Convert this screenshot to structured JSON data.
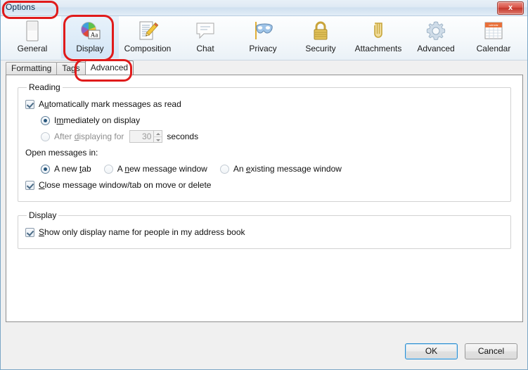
{
  "window": {
    "title": "Options",
    "close_label": "x",
    "close_icon": "close-icon"
  },
  "toolbar": {
    "items": [
      {
        "label": "General",
        "icon": "general-document-icon",
        "selected": false
      },
      {
        "label": "Display",
        "icon": "display-colorwheel-icon",
        "selected": true
      },
      {
        "label": "Composition",
        "icon": "composition-pencil-icon",
        "selected": false
      },
      {
        "label": "Chat",
        "icon": "chat-bubble-icon",
        "selected": false
      },
      {
        "label": "Privacy",
        "icon": "privacy-mask-icon",
        "selected": false
      },
      {
        "label": "Security",
        "icon": "security-padlock-icon",
        "selected": false
      },
      {
        "label": "Attachments",
        "icon": "attachments-paperclip-icon",
        "selected": false
      },
      {
        "label": "Advanced",
        "icon": "advanced-gear-icon",
        "selected": false
      },
      {
        "label": "Calendar",
        "icon": "calendar-icon",
        "selected": false
      }
    ]
  },
  "tabs": [
    {
      "label": "Formatting",
      "active": false
    },
    {
      "label": "Tags",
      "active": false
    },
    {
      "label": "Advanced",
      "active": true
    }
  ],
  "reading": {
    "legend": "Reading",
    "auto_mark": {
      "label_pre": "A",
      "label_accel": "u",
      "label_post": "tomatically mark messages as read",
      "checked": true
    },
    "immediately": {
      "label_pre": "I",
      "label_accel": "m",
      "label_post": "mediately on display",
      "selected": true
    },
    "after_displaying": {
      "label_pre": "After ",
      "label_accel": "d",
      "label_post": "isplaying for",
      "selected": false,
      "value": "30",
      "units": "seconds"
    },
    "open_messages_label": "Open messages in:",
    "open_options": [
      {
        "pre": "A new ",
        "accel": "t",
        "post": "ab",
        "selected": true
      },
      {
        "pre": "A ",
        "accel": "n",
        "post": "ew message window",
        "selected": false
      },
      {
        "pre": "An ",
        "accel": "e",
        "post": "xisting message window",
        "selected": false
      }
    ],
    "close_on_move": {
      "label_pre": "",
      "label_accel": "C",
      "label_post": "lose message window/tab on move or delete",
      "checked": true
    }
  },
  "display": {
    "legend": "Display",
    "show_only_display_name": {
      "label_pre": "",
      "label_accel": "S",
      "label_post": "how only display name for people in my address book",
      "checked": true
    }
  },
  "footer": {
    "ok_label": "OK",
    "cancel_label": "Cancel"
  },
  "colors": {
    "accent": "#2c8fd1",
    "annotation": "#e01b1b",
    "close_red": "#c3362c",
    "selected_tab_bg": "#d2e5f6"
  }
}
